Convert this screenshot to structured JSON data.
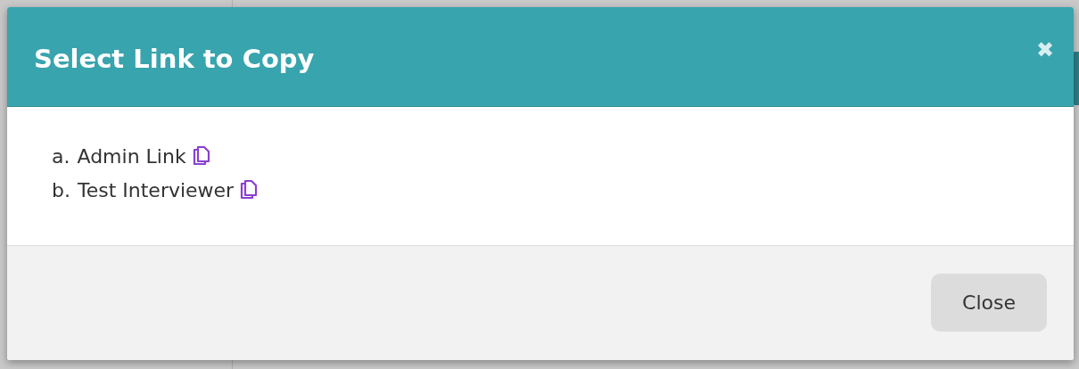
{
  "dialog": {
    "title": "Select Link to Copy",
    "close_icon": "✖",
    "links": [
      {
        "marker": "a.",
        "label": "Admin Link"
      },
      {
        "marker": "b.",
        "label": "Test Interviewer"
      }
    ],
    "buttons": [
      "Close"
    ]
  }
}
